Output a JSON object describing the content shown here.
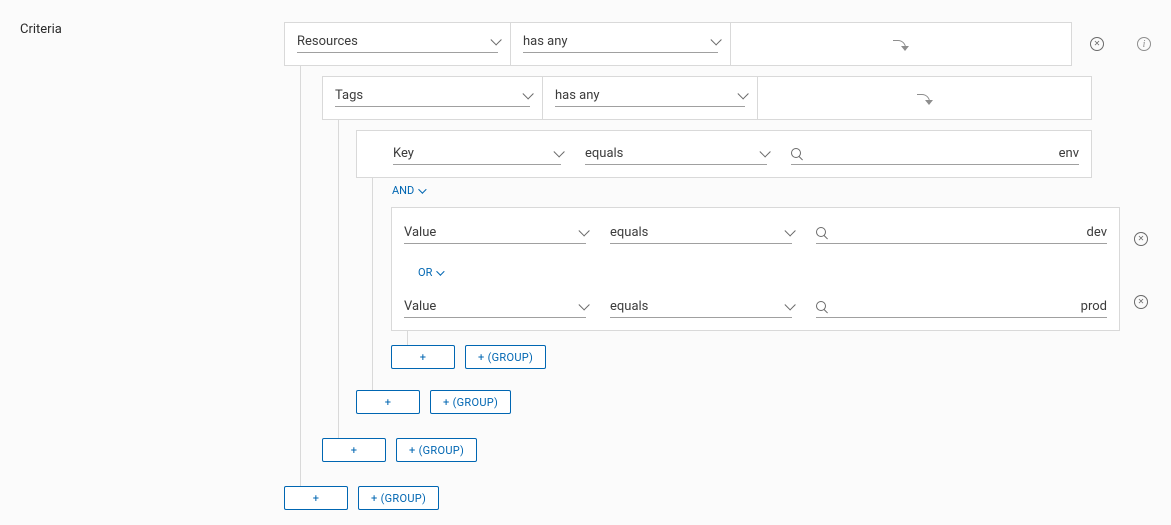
{
  "title": "Criteria",
  "connectors": {
    "and": "AND",
    "or": "OR"
  },
  "buttons": {
    "plus": "+",
    "group": "+ (GROUP)"
  },
  "row1": {
    "subject": "Resources",
    "operator": "has any"
  },
  "row2": {
    "subject": "Tags",
    "operator": "has any"
  },
  "row3": {
    "subject": "Key",
    "operator": "equals",
    "value": "env"
  },
  "row4": {
    "subject": "Value",
    "operator": "equals",
    "value": "dev"
  },
  "row5": {
    "subject": "Value",
    "operator": "equals",
    "value": "prod"
  }
}
